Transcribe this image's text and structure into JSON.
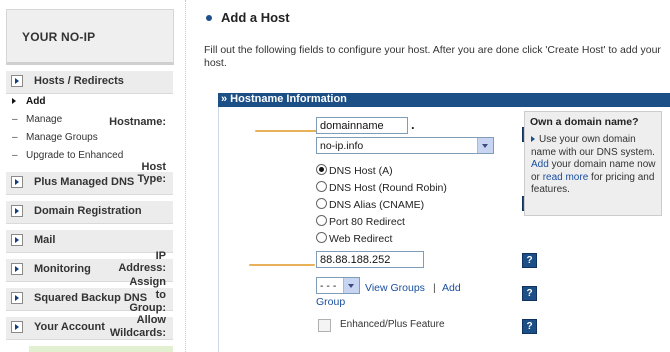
{
  "sidebar": {
    "brand": "YOUR NO-IP",
    "sections": [
      {
        "label": "Hosts / Redirects"
      },
      {
        "label": "Plus Managed DNS"
      },
      {
        "label": "Domain Registration"
      },
      {
        "label": "Mail"
      },
      {
        "label": "Monitoring"
      },
      {
        "label": "Squared Backup DNS"
      },
      {
        "label": "Your Account"
      }
    ],
    "sub_items": [
      {
        "label": "Add",
        "active": true
      },
      {
        "label": "Manage"
      },
      {
        "label": "Manage Groups"
      },
      {
        "label": "Upgrade to Enhanced"
      }
    ]
  },
  "main": {
    "title": "Add a Host",
    "intro": "Fill out the following fields to configure your host. After you are done click 'Create Host' to add your host.",
    "panel_title": "» Hostname Information",
    "form": {
      "hostname_label": "Hostname:",
      "hostname_value": "domainname",
      "hostname_dot": ".",
      "domain_selected": "no-ip.info",
      "host_type_label": "Host Type:",
      "host_types": [
        "DNS Host (A)",
        "DNS Host (Round Robin)",
        "DNS Alias (CNAME)",
        "Port 80 Redirect",
        "Web Redirect"
      ],
      "host_type_selected": "DNS Host (A)",
      "ip_label": "IP Address:",
      "ip_value": "88.88.188.252",
      "assign_label_1": "Assign to",
      "assign_label_2": "Group:",
      "group_selected": "- - -",
      "view_groups": "View Groups",
      "separator": "|",
      "add_group_1": "Add",
      "add_group_2": "Group",
      "wildcards_label_1": "Allow",
      "wildcards_label_2": "Wildcards:",
      "wildcards_feature": "Enhanced/Plus Feature",
      "help_glyph": "?"
    },
    "domain_box": {
      "title": "Own a domain name?",
      "text_1": "Use your own domain name with our DNS system.",
      "link_add": "Add",
      "text_2": "your domain name now or",
      "link_read": "read more",
      "text_3": "for pricing and features."
    }
  },
  "colors": {
    "header_blue": "#1c4f86",
    "link_blue": "#1a4fa0",
    "highlight_underline": "#e8b15a"
  }
}
